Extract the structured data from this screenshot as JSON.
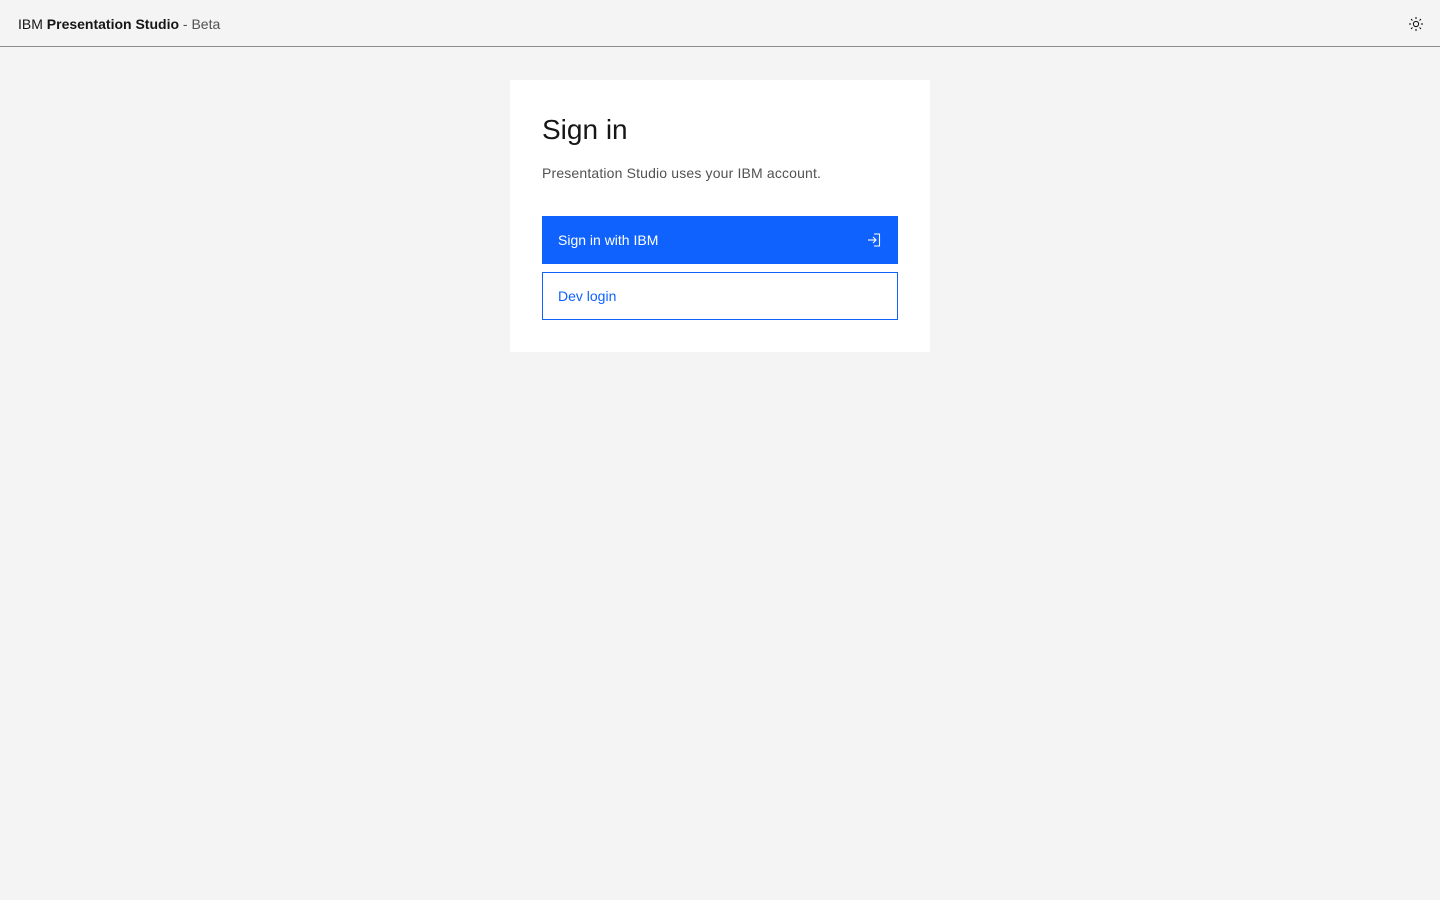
{
  "header": {
    "brand_prefix": "IBM",
    "brand_name": "Presentation Studio",
    "brand_separator": " - ",
    "brand_suffix": "Beta",
    "theme_toggle_icon": "sun-icon"
  },
  "signin": {
    "title": "Sign in",
    "subtitle": "Presentation Studio uses your IBM account.",
    "primary_button_label": "Sign in with IBM",
    "primary_button_icon": "login-icon",
    "secondary_button_label": "Dev login"
  },
  "colors": {
    "page_background": "#f4f4f4",
    "card_background": "#ffffff",
    "primary": "#0f62fe",
    "text_primary": "#161616",
    "text_secondary": "#525252",
    "header_border": "#8d8d8d"
  }
}
